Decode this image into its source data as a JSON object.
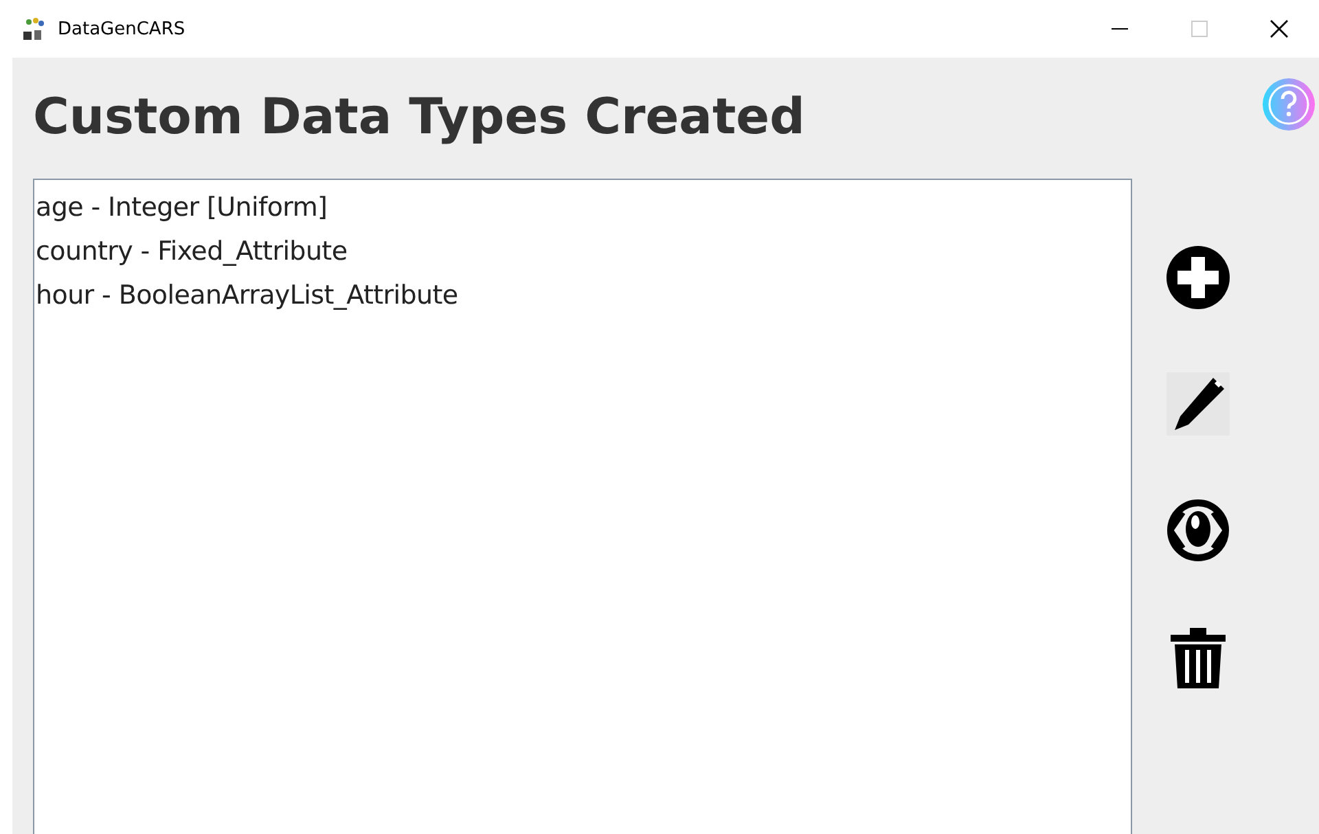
{
  "window": {
    "title": "DataGenCARS"
  },
  "heading": "Custom Data Types Created",
  "items": [
    "age - Integer [Uniform]",
    "country - Fixed_Attribute",
    "hour - BooleanArrayList_Attribute"
  ]
}
